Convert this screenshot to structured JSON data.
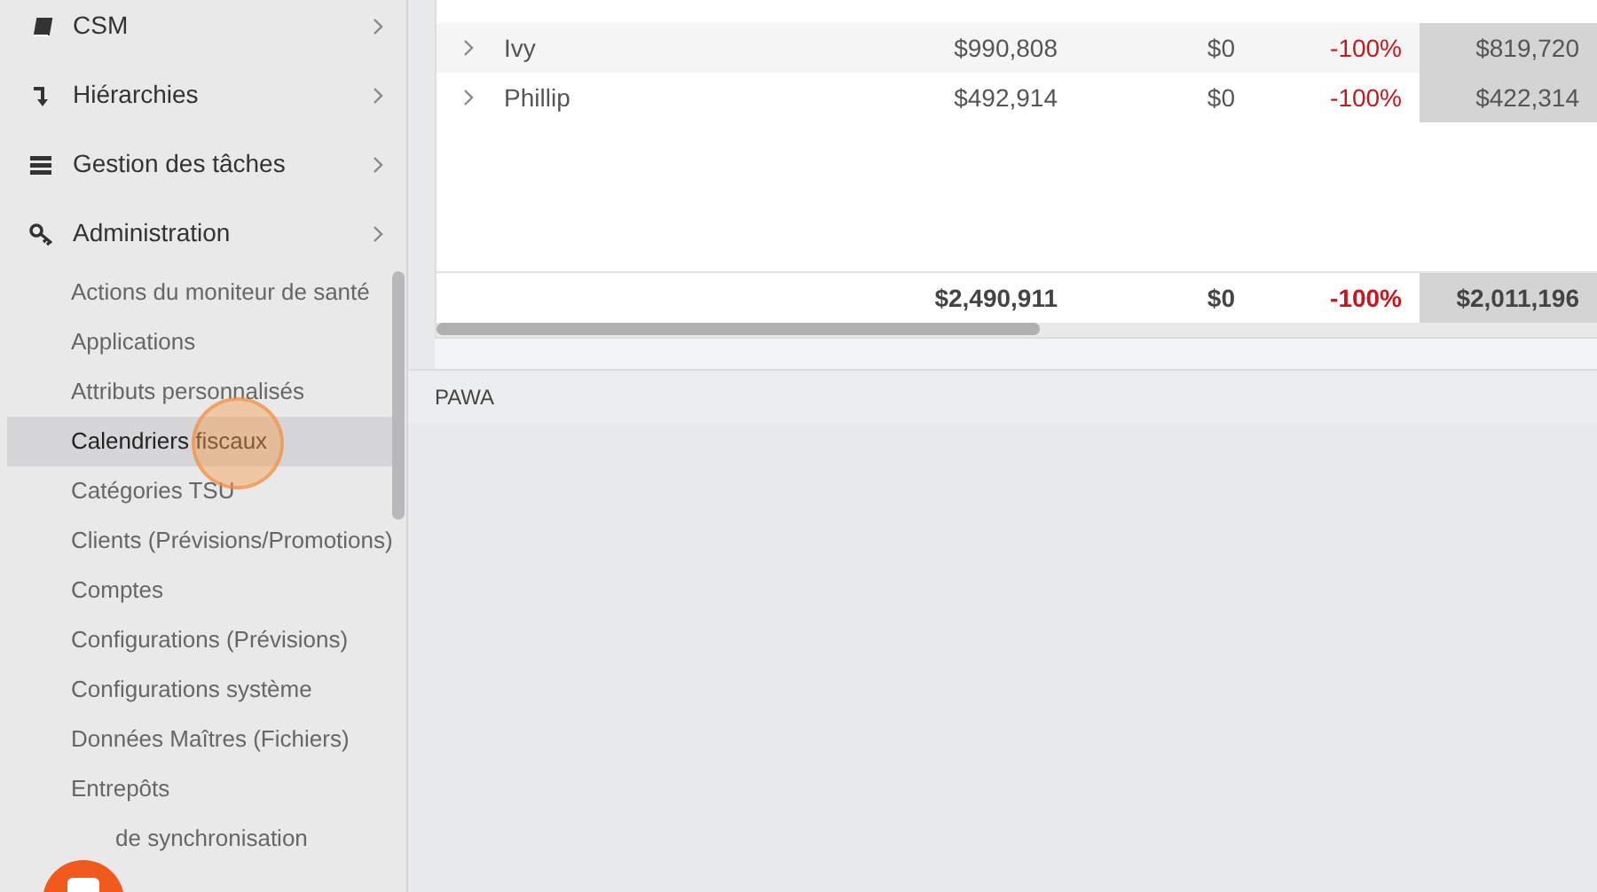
{
  "sidebar": {
    "sections": [
      {
        "label": "CSM"
      },
      {
        "label": "Hiérarchies"
      },
      {
        "label": "Gestion des tâches"
      },
      {
        "label": "Administration"
      }
    ],
    "items": [
      {
        "label": "Actions du moniteur de santé",
        "selected": false
      },
      {
        "label": "Applications",
        "selected": false
      },
      {
        "label": "Attributs personnalisés",
        "selected": false
      },
      {
        "label": "Calendriers fiscaux",
        "selected": true
      },
      {
        "label": "Catégories TSU",
        "selected": false
      },
      {
        "label": "Clients (Prévisions/Promotions)",
        "selected": false
      },
      {
        "label": "Comptes",
        "selected": false
      },
      {
        "label": "Configurations (Prévisions)",
        "selected": false
      },
      {
        "label": "Configurations système",
        "selected": false
      },
      {
        "label": "Données Maîtres (Fichiers)",
        "selected": false
      },
      {
        "label": "Entrepôts",
        "selected": false
      },
      {
        "label": "de synchronisation",
        "selected": false
      }
    ]
  },
  "table": {
    "rows": [
      {
        "name": "Ivy",
        "column_2": "$990,808",
        "column_3": "$0",
        "column_4": "-100%",
        "column_5": "$819,720"
      },
      {
        "name": "Phillip",
        "column_2": "$492,914",
        "column_3": "$0",
        "column_4": "-100%",
        "column_5": "$422,314"
      }
    ],
    "totals": {
      "column_2": "$2,490,911",
      "column_3": "$0",
      "column_4": "-100%",
      "column_5": "$2,011,196"
    }
  },
  "footer_bar": {
    "label": "PAWA"
  }
}
